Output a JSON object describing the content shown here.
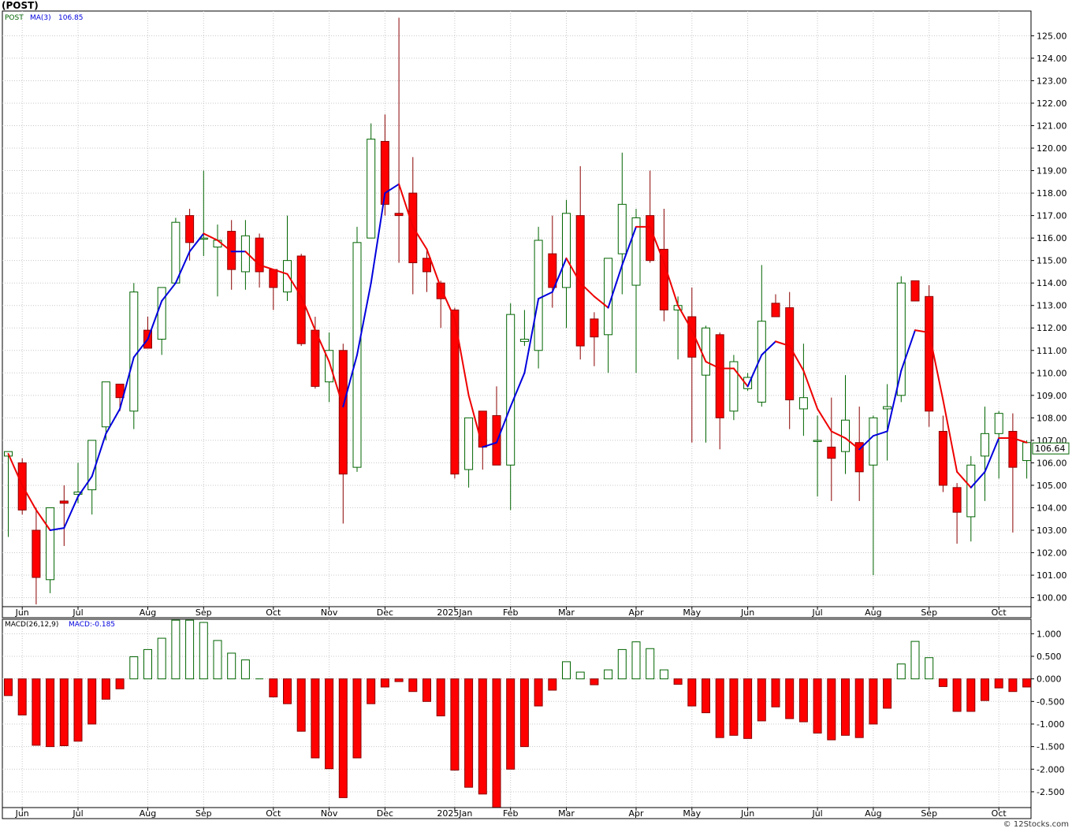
{
  "header": {
    "title": "(POST)"
  },
  "chart_data": [
    {
      "type": "candlestick",
      "legend": {
        "ticker": "POST",
        "ma_label": "MA(3)",
        "ma_value": "106.85"
      },
      "y_ticks": [
        "100.00",
        "101.00",
        "102.00",
        "103.00",
        "104.00",
        "105.00",
        "106.00",
        "107.00",
        "108.00",
        "109.00",
        "110.00",
        "111.00",
        "112.00",
        "113.00",
        "114.00",
        "115.00",
        "116.00",
        "117.00",
        "118.00",
        "119.00",
        "120.00",
        "121.00",
        "122.00",
        "123.00",
        "124.00",
        "125.00"
      ],
      "ylim": [
        99.6,
        126.1
      ],
      "x_labels": [
        {
          "i": 1,
          "t": "Jun"
        },
        {
          "i": 5,
          "t": "Jul"
        },
        {
          "i": 10,
          "t": "Aug"
        },
        {
          "i": 14,
          "t": "Sep"
        },
        {
          "i": 19,
          "t": "Oct"
        },
        {
          "i": 23,
          "t": "Nov"
        },
        {
          "i": 27,
          "t": "Dec"
        },
        {
          "i": 32,
          "t": "2025Jan"
        },
        {
          "i": 36,
          "t": "Feb"
        },
        {
          "i": 40,
          "t": "Mar"
        },
        {
          "i": 45,
          "t": "Apr"
        },
        {
          "i": 49,
          "t": "May"
        },
        {
          "i": 53,
          "t": "Jun"
        },
        {
          "i": 58,
          "t": "Jul"
        },
        {
          "i": 62,
          "t": "Aug"
        },
        {
          "i": 66,
          "t": "Sep"
        },
        {
          "i": 71,
          "t": "Oct"
        }
      ],
      "last_price": "106.64",
      "candles": [
        [
          106.3,
          106.5,
          102.7,
          106.5
        ],
        [
          106.0,
          106.2,
          103.7,
          103.9
        ],
        [
          103.0,
          104.0,
          99.7,
          100.9
        ],
        [
          100.8,
          104.0,
          100.2,
          104.0
        ],
        [
          104.3,
          105.0,
          102.3,
          104.2
        ],
        [
          104.6,
          106.0,
          104.2,
          104.7
        ],
        [
          104.8,
          107.0,
          103.7,
          107.0
        ],
        [
          107.6,
          109.3,
          107.0,
          109.6
        ],
        [
          109.5,
          109.5,
          108.3,
          108.9
        ],
        [
          108.3,
          114.0,
          107.5,
          113.6
        ],
        [
          111.9,
          112.5,
          111.6,
          111.1
        ],
        [
          111.5,
          113.8,
          110.8,
          113.8
        ],
        [
          114.0,
          116.9,
          114.0,
          116.7
        ],
        [
          117.0,
          117.3,
          115.0,
          115.8
        ],
        [
          116.0,
          119.0,
          115.2,
          116.0
        ],
        [
          115.6,
          116.6,
          113.4,
          115.9
        ],
        [
          116.3,
          116.8,
          113.7,
          114.6
        ],
        [
          114.5,
          116.8,
          113.7,
          116.1
        ],
        [
          116.0,
          116.2,
          113.8,
          114.5
        ],
        [
          114.6,
          114.6,
          112.8,
          113.8
        ],
        [
          113.6,
          117.0,
          113.2,
          115.0
        ],
        [
          115.2,
          115.3,
          111.2,
          111.3
        ],
        [
          111.9,
          112.5,
          109.3,
          109.4
        ],
        [
          109.6,
          111.8,
          108.7,
          111.0
        ],
        [
          111.0,
          111.3,
          103.3,
          105.5
        ],
        [
          105.8,
          116.5,
          105.6,
          115.8
        ],
        [
          116.0,
          121.1,
          116.0,
          120.4
        ],
        [
          120.3,
          121.5,
          117.0,
          117.5
        ],
        [
          117.1,
          125.8,
          114.9,
          117.0
        ],
        [
          118.0,
          119.6,
          113.5,
          114.9
        ],
        [
          115.1,
          115.5,
          113.6,
          114.5
        ],
        [
          114.0,
          114.1,
          112.0,
          113.3
        ],
        [
          112.8,
          112.9,
          105.3,
          105.5
        ],
        [
          105.7,
          108.0,
          104.9,
          108.0
        ],
        [
          108.3,
          108.3,
          105.7,
          106.7
        ],
        [
          108.1,
          109.4,
          106.0,
          105.9
        ],
        [
          105.9,
          113.1,
          103.9,
          112.6
        ],
        [
          111.4,
          112.8,
          111.2,
          111.5
        ],
        [
          111.0,
          116.5,
          110.2,
          115.9
        ],
        [
          115.3,
          117.0,
          112.9,
          113.8
        ],
        [
          113.8,
          117.7,
          112.0,
          117.1
        ],
        [
          117.0,
          119.2,
          110.6,
          111.2
        ],
        [
          112.4,
          112.7,
          110.3,
          111.6
        ],
        [
          111.7,
          115.0,
          110.0,
          115.1
        ],
        [
          115.3,
          119.8,
          113.5,
          117.5
        ],
        [
          113.9,
          117.3,
          110.0,
          116.9
        ],
        [
          117.0,
          119.0,
          114.9,
          115.0
        ],
        [
          115.5,
          117.3,
          112.3,
          112.8
        ],
        [
          112.8,
          113.4,
          110.6,
          113.0
        ],
        [
          112.5,
          113.8,
          106.9,
          110.7
        ],
        [
          109.9,
          112.1,
          106.9,
          112.0
        ],
        [
          111.7,
          111.8,
          106.6,
          108.0
        ],
        [
          108.3,
          110.8,
          107.9,
          110.5
        ],
        [
          109.3,
          110.0,
          109.2,
          109.8
        ],
        [
          108.7,
          114.8,
          108.5,
          112.3
        ],
        [
          113.1,
          113.5,
          112.8,
          112.5
        ],
        [
          112.9,
          113.6,
          107.5,
          108.8
        ],
        [
          108.4,
          111.3,
          107.2,
          108.9
        ],
        [
          107.0,
          108.1,
          104.5,
          107.0
        ],
        [
          106.7,
          108.9,
          104.3,
          106.2
        ],
        [
          106.5,
          109.9,
          105.5,
          107.9
        ],
        [
          106.9,
          108.5,
          104.3,
          105.6
        ],
        [
          105.9,
          108.1,
          101.0,
          108.0
        ],
        [
          108.4,
          109.5,
          106.1,
          108.5
        ],
        [
          109.0,
          114.3,
          108.7,
          114.0
        ],
        [
          114.1,
          114.1,
          113.2,
          113.2
        ],
        [
          113.4,
          113.9,
          107.6,
          108.3
        ],
        [
          107.4,
          108.1,
          104.7,
          105.0
        ],
        [
          104.9,
          105.1,
          102.4,
          103.8
        ],
        [
          103.6,
          106.3,
          102.5,
          105.9
        ],
        [
          106.3,
          108.5,
          104.3,
          107.3
        ],
        [
          107.3,
          108.3,
          105.3,
          108.2
        ],
        [
          107.4,
          108.2,
          102.9,
          105.8
        ],
        [
          106.1,
          107.0,
          105.3,
          106.9
        ]
      ],
      "ma": [
        106.4,
        105.0,
        103.9,
        103.0,
        103.1,
        104.5,
        105.4,
        107.3,
        108.4,
        110.7,
        111.5,
        113.2,
        114.0,
        115.4,
        116.2,
        115.9,
        115.4,
        115.4,
        114.8,
        114.6,
        114.4,
        113.4,
        111.9,
        110.5,
        108.5,
        110.8,
        114.0,
        118.0,
        118.4,
        116.5,
        115.5,
        113.8,
        112.4,
        109.0,
        106.7,
        106.9,
        108.5,
        110.0,
        113.3,
        113.6,
        115.1,
        114.0,
        113.4,
        112.9,
        114.8,
        116.5,
        116.5,
        114.9,
        113.0,
        111.9,
        110.5,
        110.2,
        110.2,
        109.4,
        110.8,
        111.4,
        111.2,
        110.1,
        108.4,
        107.4,
        107.1,
        106.6,
        107.2,
        107.4,
        110.1,
        111.9,
        111.8,
        108.8,
        105.6,
        104.9,
        105.6,
        107.1,
        107.1,
        106.9
      ],
      "ma_up": [
        false,
        false,
        false,
        false,
        true,
        true,
        true,
        true,
        true,
        true,
        true,
        true,
        true,
        true,
        true,
        false,
        false,
        true,
        false,
        false,
        false,
        false,
        false,
        false,
        false,
        true,
        true,
        true,
        true,
        false,
        false,
        false,
        false,
        false,
        false,
        true,
        true,
        true,
        true,
        true,
        true,
        false,
        false,
        false,
        true,
        true,
        false,
        false,
        false,
        false,
        false,
        false,
        false,
        false,
        true,
        true,
        false,
        false,
        false,
        false,
        false,
        false,
        true,
        true,
        true,
        true,
        false,
        false,
        false,
        false,
        true,
        true,
        false,
        false
      ]
    },
    {
      "type": "bar",
      "legend": {
        "label": "MACD(26,12,9)",
        "value_label": "MACD:-0.185"
      },
      "y_ticks": [
        "1.000",
        "0.500",
        "0.000",
        "-0.500",
        "-1.000",
        "-1.500",
        "-2.000",
        "-2.500"
      ],
      "ylim": [
        -2.85,
        1.32
      ],
      "x_labels": [
        {
          "i": 1,
          "t": "Jun"
        },
        {
          "i": 5,
          "t": "Jul"
        },
        {
          "i": 10,
          "t": "Aug"
        },
        {
          "i": 14,
          "t": "Sep"
        },
        {
          "i": 19,
          "t": "Oct"
        },
        {
          "i": 23,
          "t": "Nov"
        },
        {
          "i": 27,
          "t": "Dec"
        },
        {
          "i": 32,
          "t": "2025Jan"
        },
        {
          "i": 36,
          "t": "Feb"
        },
        {
          "i": 40,
          "t": "Mar"
        },
        {
          "i": 45,
          "t": "Apr"
        },
        {
          "i": 49,
          "t": "May"
        },
        {
          "i": 53,
          "t": "Jun"
        },
        {
          "i": 58,
          "t": "Jul"
        },
        {
          "i": 62,
          "t": "Aug"
        },
        {
          "i": 66,
          "t": "Sep"
        },
        {
          "i": 71,
          "t": "Oct"
        }
      ],
      "values": [
        -0.37,
        -0.8,
        -1.47,
        -1.5,
        -1.48,
        -1.38,
        -1.0,
        -0.45,
        -0.22,
        0.49,
        0.65,
        0.9,
        1.3,
        1.3,
        1.25,
        0.85,
        0.57,
        0.42,
        0.0,
        -0.4,
        -0.55,
        -1.16,
        -1.75,
        -1.99,
        -2.63,
        -1.75,
        -0.55,
        -0.18,
        -0.06,
        -0.28,
        -0.5,
        -0.82,
        -2.02,
        -2.4,
        -2.55,
        -2.85,
        -2.0,
        -1.5,
        -0.6,
        -0.25,
        0.38,
        0.15,
        -0.13,
        0.2,
        0.65,
        0.82,
        0.67,
        0.2,
        -0.12,
        -0.6,
        -0.75,
        -1.3,
        -1.25,
        -1.32,
        -0.93,
        -0.62,
        -0.88,
        -0.95,
        -1.2,
        -1.35,
        -1.25,
        -1.3,
        -1.0,
        -0.65,
        0.33,
        0.83,
        0.47,
        -0.17,
        -0.72,
        -0.72,
        -0.48,
        -0.2,
        -0.28,
        -0.18
      ]
    }
  ],
  "footer": {
    "credit": "© 12Stocks.com"
  }
}
